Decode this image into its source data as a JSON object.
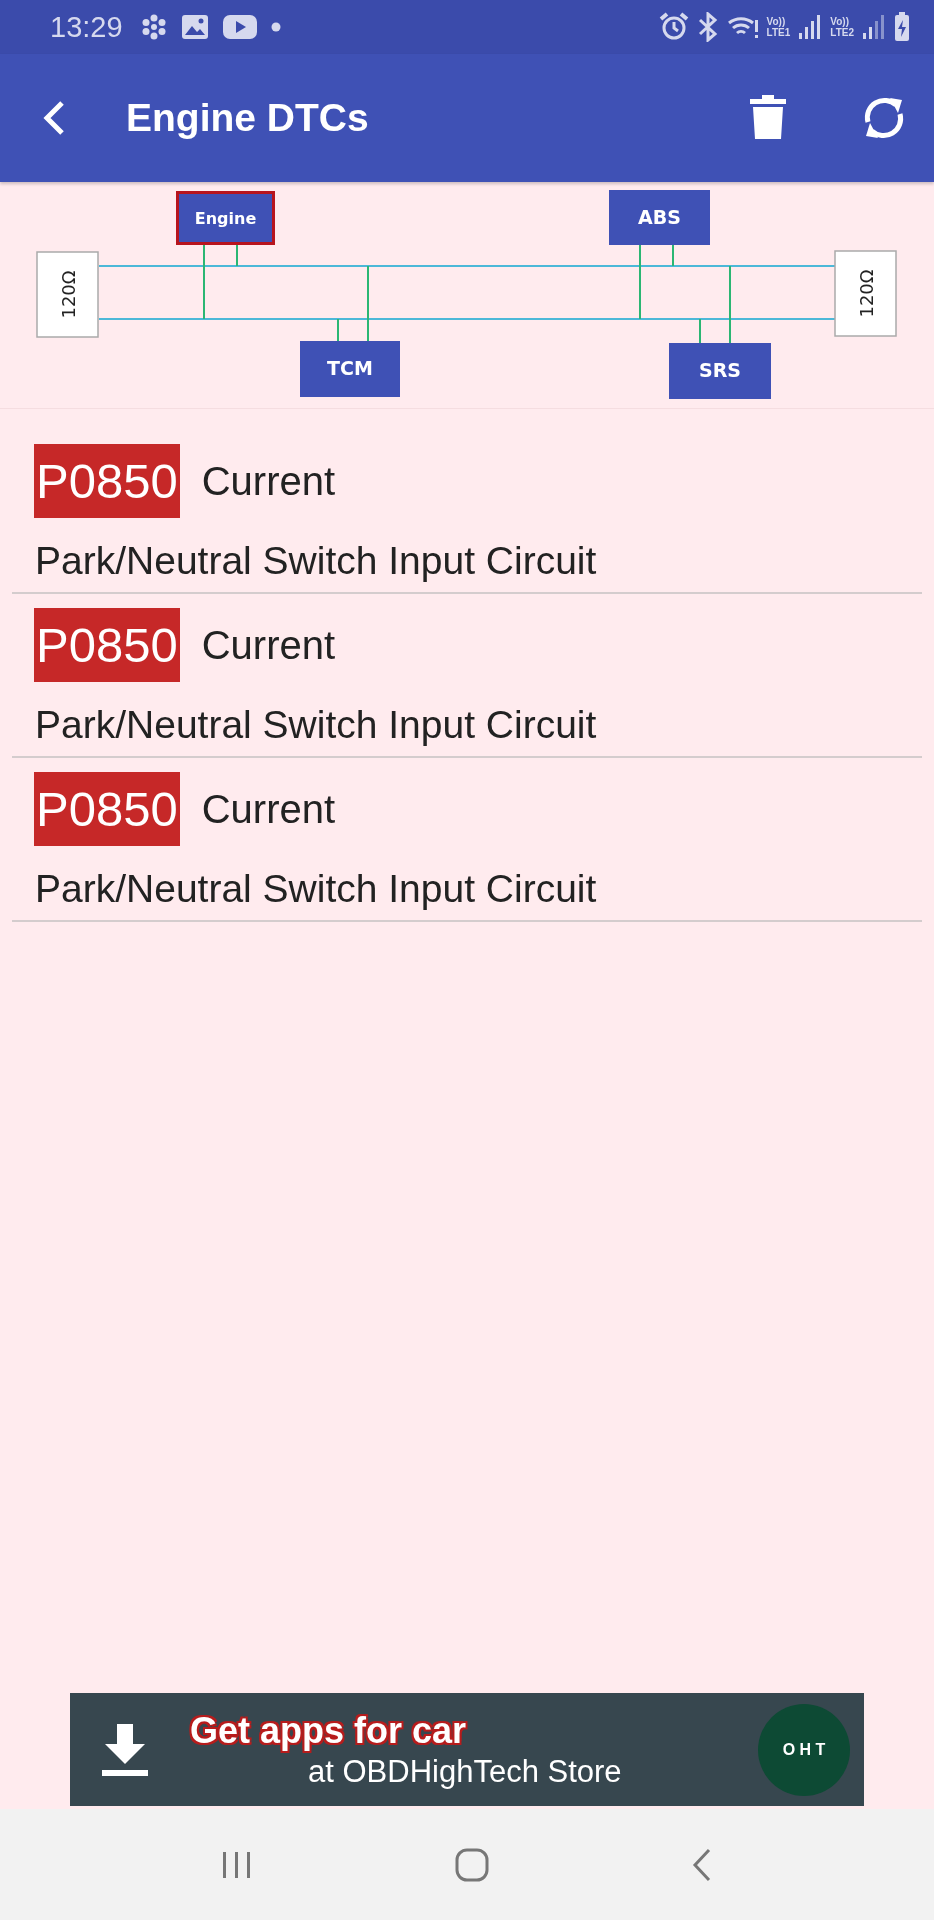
{
  "status_bar": {
    "time": "13:29",
    "sim_labels": [
      "Vo))\nLTE1",
      "Vo))\nLTE2"
    ]
  },
  "app_bar": {
    "title": "Engine DTCs"
  },
  "bus_diagram": {
    "modules": [
      {
        "label": "Engine",
        "selected": true
      },
      {
        "label": "ABS",
        "selected": false
      },
      {
        "label": "TCM",
        "selected": false
      },
      {
        "label": "SRS",
        "selected": false
      }
    ],
    "terminators": [
      "120Ω",
      "120Ω"
    ]
  },
  "dtcs": [
    {
      "code": "P0850",
      "status": "Current",
      "description": "Park/Neutral Switch Input Circuit"
    },
    {
      "code": "P0850",
      "status": "Current",
      "description": "Park/Neutral Switch Input Circuit"
    },
    {
      "code": "P0850",
      "status": "Current",
      "description": "Park/Neutral Switch Input Circuit"
    }
  ],
  "banner": {
    "headline": "Get apps for car",
    "subline": "at OBDHighTech Store",
    "logo_text": "O H T"
  }
}
